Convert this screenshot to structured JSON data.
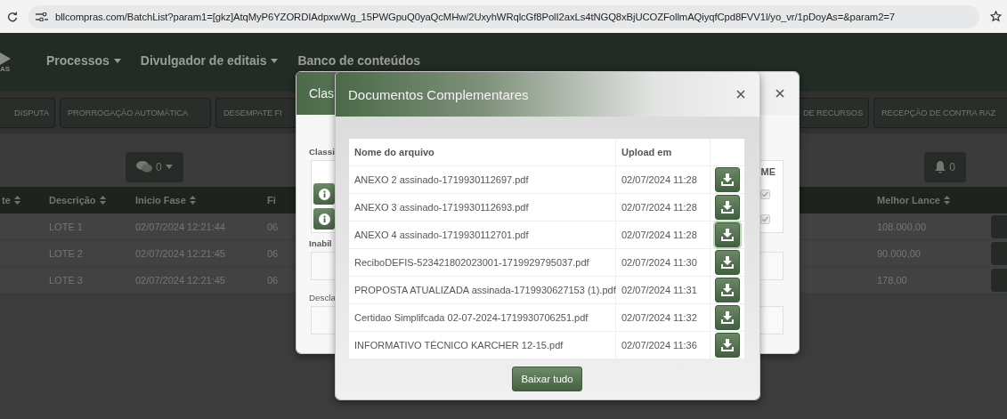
{
  "browser": {
    "url": "bllcompras.com/BatchList?param1=[gkz]AtqMyP6YZORDIAdpxwWg_15PWGpuQ0yaQcMHw/2UxyhWRqlcGf8PolI2axLs4tNGQ8xBjUCOZFollmAQiyqfCpd8FVV1l/yo_vr/1pDoyAs=&param2=7"
  },
  "nav": {
    "logo_text": "AS",
    "menus": [
      {
        "label": "Processos",
        "dropdown": true
      },
      {
        "label": "Divulgador de editais",
        "dropdown": true
      },
      {
        "label": "Banco de conteúdos",
        "dropdown": false
      }
    ]
  },
  "phase_tabs": {
    "left": [
      "DISPUTA",
      "PRORROGAÇÃO AUTOMÁTICA",
      "DESEMPATE FI"
    ],
    "right": [
      "DE RECURSOS",
      "RECEPÇÃO DE CONTRA RAZ"
    ]
  },
  "toolbar": {
    "messages_count": "0",
    "notifications_count": "0"
  },
  "lots_table": {
    "columns": [
      {
        "label": "te",
        "sortable": true
      },
      {
        "label": "Descrição",
        "sortable": true
      },
      {
        "label": "Inicio Fase",
        "sortable": true
      },
      {
        "label": "Fi",
        "sortable": false
      },
      {
        "label": "Melhor Lance",
        "sortable": true
      }
    ],
    "rows": [
      {
        "descricao": "LOTE 1",
        "inicio_fase": "02/07/2024 12:21:44",
        "column_4": "06",
        "melhor_lance": "108.000,00"
      },
      {
        "descricao": "LOTE 2",
        "inicio_fase": "02/07/2024 12:21:45",
        "column_4": "06",
        "melhor_lance": "90.000,00"
      },
      {
        "descricao": "LOTE 3",
        "inicio_fase": "02/07/2024 12:21:45",
        "column_4": "06",
        "melhor_lance": "178,00"
      }
    ]
  },
  "classification_dialog": {
    "title": "Clas",
    "section_1": "Classi",
    "column_me": "ME",
    "rows": [
      {
        "checked": true
      },
      {
        "checked": true
      }
    ],
    "section_2": "Inabil",
    "section_3": "Descla"
  },
  "documents_dialog": {
    "title": "Documentos Complementares",
    "columns": [
      "Nome do arquivo",
      "Upload em"
    ],
    "files": [
      {
        "name": "ANEXO 2 assinado-1719930112697.pdf",
        "uploaded": "02/07/2024 11:28",
        "focused": false
      },
      {
        "name": "ANEXO 3 assinado-1719930112693.pdf",
        "uploaded": "02/07/2024 11:28",
        "focused": false
      },
      {
        "name": "ANEXO 4 assinado-1719930112701.pdf",
        "uploaded": "02/07/2024 11:28",
        "focused": true
      },
      {
        "name": "ReciboDEFIS-523421802023001-1719929795037.pdf",
        "uploaded": "02/07/2024 11:30",
        "focused": false
      },
      {
        "name": "PROPOSTA ATUALIZADA assinada-1719930627153 (1).pdf",
        "uploaded": "02/07/2024 11:31",
        "focused": false
      },
      {
        "name": "Certidao Simplifcada 02-07-2024-1719930706251.pdf",
        "uploaded": "02/07/2024 11:32",
        "focused": false
      },
      {
        "name": "INFORMATIVO TÉCNICO KARCHER 12-15.pdf",
        "uploaded": "02/07/2024 11:36",
        "focused": false
      }
    ],
    "download_all": "Baixar tudo"
  }
}
